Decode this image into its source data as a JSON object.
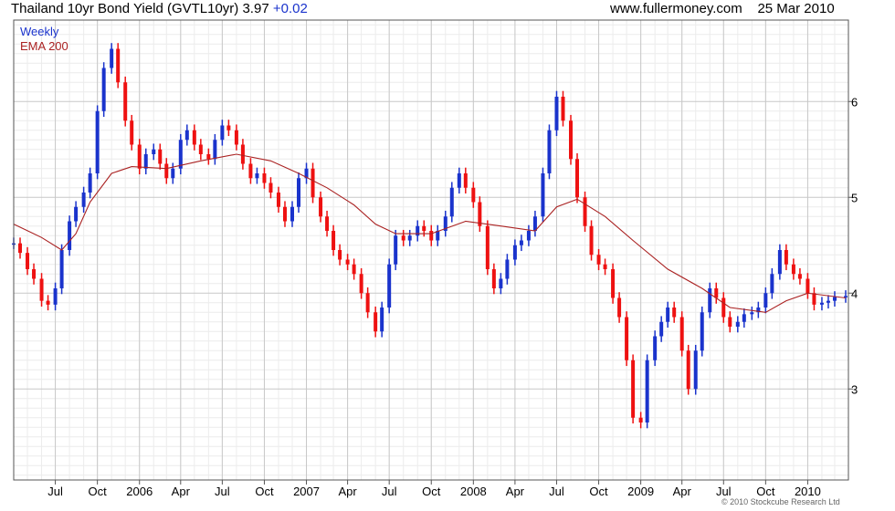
{
  "header": {
    "title": "Thailand 10yr Bond Yield (GVTL10yr)",
    "last_value": "3.97",
    "change": "+0.02",
    "source": "www.fullermoney.com",
    "date": "25 Mar 2010"
  },
  "legend": {
    "weekly": "Weekly",
    "ema": "EMA 200"
  },
  "credit": "© 2010 Stockcube Research Ltd",
  "colors": {
    "up": "#1a33cc",
    "down": "#ee1111",
    "ema": "#aa2222",
    "grid_major": "#c8c8c8",
    "grid_minor": "#ececec",
    "frame": "#555555"
  },
  "chart_data": {
    "type": "candlestick",
    "interval": "weekly",
    "ylim": [
      2.05,
      6.85
    ],
    "y_ticks": [
      3,
      4,
      5,
      6
    ],
    "y_tick_labels": [
      "3",
      "4",
      "5",
      "6"
    ],
    "x_start": "2005-04-01",
    "x_end": "2010-03-31",
    "x_ticks": [
      {
        "label": "Jul",
        "date": "2005-07-01"
      },
      {
        "label": "Oct",
        "date": "2005-10-01"
      },
      {
        "label": "2006",
        "date": "2006-01-01"
      },
      {
        "label": "Apr",
        "date": "2006-04-01"
      },
      {
        "label": "Jul",
        "date": "2006-07-01"
      },
      {
        "label": "Oct",
        "date": "2006-10-01"
      },
      {
        "label": "2007",
        "date": "2007-01-01"
      },
      {
        "label": "Apr",
        "date": "2007-04-01"
      },
      {
        "label": "Jul",
        "date": "2007-07-01"
      },
      {
        "label": "Oct",
        "date": "2007-10-01"
      },
      {
        "label": "2008",
        "date": "2008-01-01"
      },
      {
        "label": "Apr",
        "date": "2008-04-01"
      },
      {
        "label": "Jul",
        "date": "2008-07-01"
      },
      {
        "label": "Oct",
        "date": "2008-10-01"
      },
      {
        "label": "2009",
        "date": "2009-01-01"
      },
      {
        "label": "Apr",
        "date": "2009-04-01"
      },
      {
        "label": "Jul",
        "date": "2009-07-01"
      },
      {
        "label": "Oct",
        "date": "2009-10-01"
      },
      {
        "label": "2010",
        "date": "2010-01-01"
      }
    ],
    "close_series": {
      "name": "Weekly",
      "points": [
        [
          "2005-04-01",
          4.52
        ],
        [
          "2005-04-15",
          4.42
        ],
        [
          "2005-05-01",
          4.25
        ],
        [
          "2005-05-15",
          4.15
        ],
        [
          "2005-06-01",
          3.92
        ],
        [
          "2005-06-15",
          3.88
        ],
        [
          "2005-07-01",
          4.05
        ],
        [
          "2005-07-15",
          4.45
        ],
        [
          "2005-08-01",
          4.75
        ],
        [
          "2005-08-15",
          4.9
        ],
        [
          "2005-09-01",
          5.05
        ],
        [
          "2005-09-15",
          5.25
        ],
        [
          "2005-10-01",
          5.9
        ],
        [
          "2005-10-15",
          6.35
        ],
        [
          "2005-11-01",
          6.55
        ],
        [
          "2005-11-15",
          6.2
        ],
        [
          "2005-12-01",
          5.8
        ],
        [
          "2005-12-15",
          5.55
        ],
        [
          "2006-01-01",
          5.3
        ],
        [
          "2006-01-15",
          5.45
        ],
        [
          "2006-02-01",
          5.5
        ],
        [
          "2006-02-15",
          5.35
        ],
        [
          "2006-03-01",
          5.2
        ],
        [
          "2006-03-15",
          5.3
        ],
        [
          "2006-04-01",
          5.6
        ],
        [
          "2006-04-15",
          5.7
        ],
        [
          "2006-05-01",
          5.55
        ],
        [
          "2006-05-15",
          5.45
        ],
        [
          "2006-06-01",
          5.4
        ],
        [
          "2006-06-15",
          5.6
        ],
        [
          "2006-07-01",
          5.75
        ],
        [
          "2006-07-15",
          5.7
        ],
        [
          "2006-08-01",
          5.55
        ],
        [
          "2006-08-15",
          5.35
        ],
        [
          "2006-09-01",
          5.2
        ],
        [
          "2006-09-15",
          5.25
        ],
        [
          "2006-10-01",
          5.15
        ],
        [
          "2006-10-15",
          5.05
        ],
        [
          "2006-11-01",
          4.9
        ],
        [
          "2006-11-15",
          4.75
        ],
        [
          "2006-12-01",
          4.9
        ],
        [
          "2006-12-15",
          5.2
        ],
        [
          "2007-01-01",
          5.3
        ],
        [
          "2007-01-15",
          5.0
        ],
        [
          "2007-02-01",
          4.8
        ],
        [
          "2007-02-15",
          4.65
        ],
        [
          "2007-03-01",
          4.45
        ],
        [
          "2007-03-15",
          4.35
        ],
        [
          "2007-04-01",
          4.3
        ],
        [
          "2007-04-15",
          4.2
        ],
        [
          "2007-05-01",
          4.0
        ],
        [
          "2007-05-15",
          3.8
        ],
        [
          "2007-06-01",
          3.6
        ],
        [
          "2007-06-15",
          3.85
        ],
        [
          "2007-07-01",
          4.3
        ],
        [
          "2007-07-15",
          4.6
        ],
        [
          "2007-08-01",
          4.55
        ],
        [
          "2007-08-15",
          4.6
        ],
        [
          "2007-09-01",
          4.7
        ],
        [
          "2007-09-15",
          4.65
        ],
        [
          "2007-10-01",
          4.55
        ],
        [
          "2007-10-15",
          4.65
        ],
        [
          "2007-11-01",
          4.8
        ],
        [
          "2007-11-15",
          5.1
        ],
        [
          "2007-12-01",
          5.25
        ],
        [
          "2007-12-15",
          5.1
        ],
        [
          "2008-01-01",
          4.95
        ],
        [
          "2008-01-15",
          4.7
        ],
        [
          "2008-02-01",
          4.25
        ],
        [
          "2008-02-15",
          4.05
        ],
        [
          "2008-03-01",
          4.15
        ],
        [
          "2008-03-15",
          4.35
        ],
        [
          "2008-04-01",
          4.5
        ],
        [
          "2008-04-15",
          4.55
        ],
        [
          "2008-05-01",
          4.65
        ],
        [
          "2008-05-15",
          4.8
        ],
        [
          "2008-06-01",
          5.25
        ],
        [
          "2008-06-15",
          5.7
        ],
        [
          "2008-07-01",
          6.05
        ],
        [
          "2008-07-15",
          5.8
        ],
        [
          "2008-08-01",
          5.4
        ],
        [
          "2008-08-15",
          5.0
        ],
        [
          "2008-09-01",
          4.7
        ],
        [
          "2008-09-15",
          4.4
        ],
        [
          "2008-10-01",
          4.3
        ],
        [
          "2008-10-15",
          4.25
        ],
        [
          "2008-11-01",
          3.95
        ],
        [
          "2008-11-15",
          3.75
        ],
        [
          "2008-12-01",
          3.3
        ],
        [
          "2008-12-15",
          2.7
        ],
        [
          "2009-01-01",
          2.65
        ],
        [
          "2009-01-15",
          3.3
        ],
        [
          "2009-02-01",
          3.55
        ],
        [
          "2009-02-15",
          3.7
        ],
        [
          "2009-03-01",
          3.85
        ],
        [
          "2009-03-15",
          3.75
        ],
        [
          "2009-04-01",
          3.4
        ],
        [
          "2009-04-15",
          3.0
        ],
        [
          "2009-05-01",
          3.4
        ],
        [
          "2009-05-15",
          3.8
        ],
        [
          "2009-06-01",
          4.05
        ],
        [
          "2009-06-15",
          3.95
        ],
        [
          "2009-07-01",
          3.75
        ],
        [
          "2009-07-15",
          3.65
        ],
        [
          "2009-08-01",
          3.7
        ],
        [
          "2009-08-15",
          3.78
        ],
        [
          "2009-09-01",
          3.8
        ],
        [
          "2009-09-15",
          3.85
        ],
        [
          "2009-10-01",
          4.0
        ],
        [
          "2009-10-15",
          4.2
        ],
        [
          "2009-11-01",
          4.45
        ],
        [
          "2009-11-15",
          4.3
        ],
        [
          "2009-12-01",
          4.2
        ],
        [
          "2009-12-15",
          4.15
        ],
        [
          "2010-01-01",
          4.0
        ],
        [
          "2010-01-15",
          3.88
        ],
        [
          "2010-02-01",
          3.9
        ],
        [
          "2010-02-15",
          3.92
        ],
        [
          "2010-03-01",
          3.96
        ],
        [
          "2010-03-25",
          3.97
        ]
      ]
    },
    "ema_series": {
      "name": "EMA 200",
      "points": [
        [
          "2005-04-01",
          4.72
        ],
        [
          "2005-06-01",
          4.58
        ],
        [
          "2005-07-15",
          4.45
        ],
        [
          "2005-08-15",
          4.62
        ],
        [
          "2005-09-15",
          4.95
        ],
        [
          "2005-11-01",
          5.25
        ],
        [
          "2005-12-15",
          5.32
        ],
        [
          "2006-03-01",
          5.3
        ],
        [
          "2006-05-15",
          5.38
        ],
        [
          "2006-08-01",
          5.45
        ],
        [
          "2006-10-15",
          5.38
        ],
        [
          "2006-12-15",
          5.25
        ],
        [
          "2007-02-15",
          5.1
        ],
        [
          "2007-04-15",
          4.92
        ],
        [
          "2007-06-01",
          4.72
        ],
        [
          "2007-07-15",
          4.62
        ],
        [
          "2007-10-01",
          4.62
        ],
        [
          "2007-12-15",
          4.75
        ],
        [
          "2008-03-01",
          4.7
        ],
        [
          "2008-05-15",
          4.65
        ],
        [
          "2008-07-01",
          4.9
        ],
        [
          "2008-08-15",
          4.98
        ],
        [
          "2008-10-15",
          4.8
        ],
        [
          "2008-12-15",
          4.55
        ],
        [
          "2009-03-01",
          4.25
        ],
        [
          "2009-05-15",
          4.05
        ],
        [
          "2009-07-15",
          3.85
        ],
        [
          "2009-10-01",
          3.8
        ],
        [
          "2009-11-15",
          3.92
        ],
        [
          "2010-01-01",
          4.0
        ],
        [
          "2010-03-25",
          3.95
        ]
      ]
    }
  }
}
